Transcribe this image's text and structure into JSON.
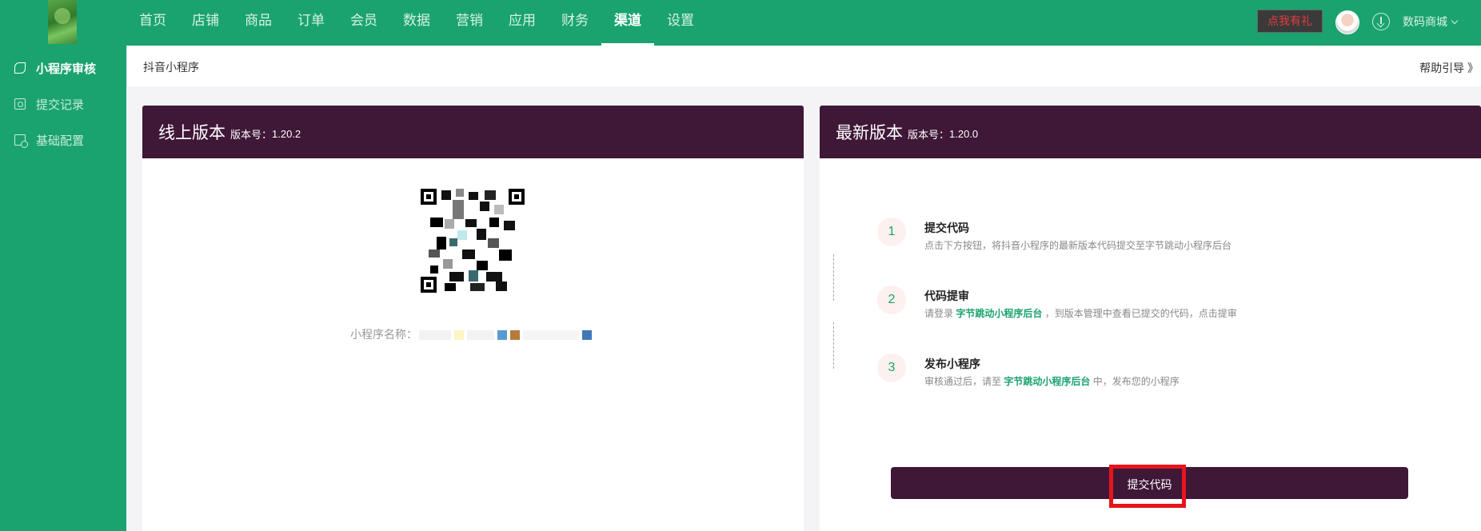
{
  "nav": {
    "items": [
      "首页",
      "店铺",
      "商品",
      "订单",
      "会员",
      "数据",
      "营销",
      "应用",
      "财务",
      "渠道",
      "设置"
    ],
    "active": "渠道"
  },
  "header": {
    "gift_label": "点我有礼",
    "shop_name": "数码商城"
  },
  "sidebar": {
    "items": [
      {
        "label": "小程序审核",
        "icon": "link-icon",
        "active": true
      },
      {
        "label": "提交记录",
        "icon": "record-icon",
        "active": false
      },
      {
        "label": "基础配置",
        "icon": "config-icon",
        "active": false
      }
    ]
  },
  "page": {
    "title": "抖音小程序",
    "help": "帮助引导 》"
  },
  "online": {
    "title": "线上版本",
    "version_label": "版本号：",
    "version": "1.20.2",
    "app_name_label": "小程序名称："
  },
  "latest": {
    "title": "最新版本",
    "version_label": "版本号：",
    "version": "1.20.0",
    "steps": [
      {
        "num": "1",
        "title": "提交代码",
        "desc_before": "点击下方按钮，将抖音小程序的最新版本代码提交至字节跳动小程序后台",
        "link": "",
        "desc_after": ""
      },
      {
        "num": "2",
        "title": "代码提审",
        "desc_before": "请登录 ",
        "link": "字节跳动小程序后台",
        "desc_after": " ，到版本管理中查看已提交的代码，点击提审"
      },
      {
        "num": "3",
        "title": "发布小程序",
        "desc_before": "审核通过后，请至 ",
        "link": "字节跳动小程序后台",
        "desc_after": " 中，发布您的小程序"
      }
    ],
    "submit_label": "提交代码"
  }
}
